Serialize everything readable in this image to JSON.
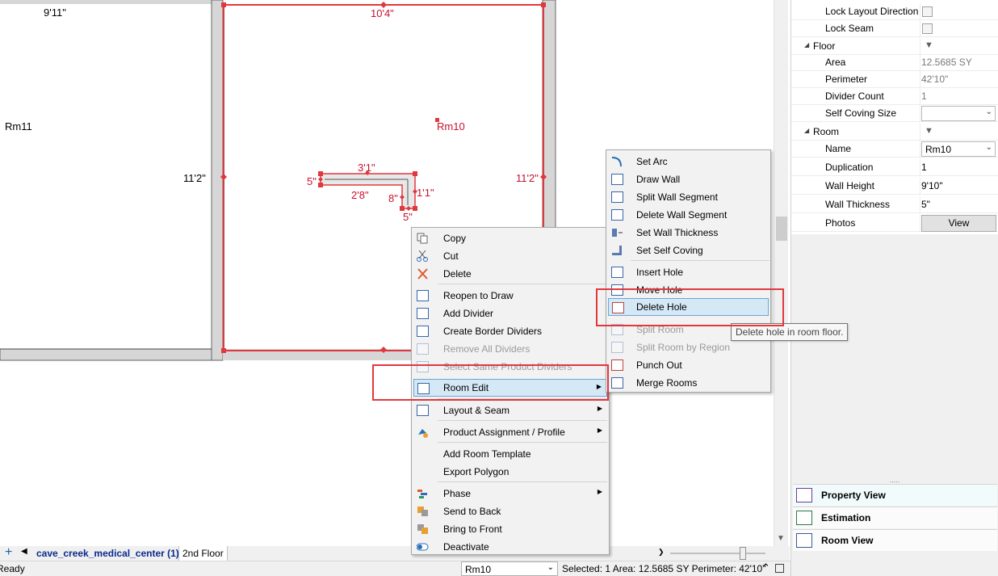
{
  "canvas": {
    "left_room": {
      "label": "Rm11",
      "dim_top": "9'11\"",
      "dim_right": "11'2\""
    },
    "room": {
      "label": "Rm10",
      "dim_top": "10'4\"",
      "dim_right": "11'2\"",
      "hole_dims": {
        "top": "3'1\"",
        "left": "5\"",
        "inner": "2'8\"",
        "step": "8\"",
        "right": "1'1\"",
        "bottom": "5\""
      }
    }
  },
  "main_menu": {
    "items": [
      {
        "label": "Copy",
        "icon": "copy-icon"
      },
      {
        "label": "Cut",
        "icon": "scissors-icon"
      },
      {
        "label": "Delete",
        "icon": "delete-x-icon"
      },
      {
        "label": "Reopen to Draw",
        "icon": "reopen-icon"
      },
      {
        "label": "Add Divider",
        "icon": "divider-icon"
      },
      {
        "label": "Create Border Dividers",
        "icon": "border-dividers-icon"
      },
      {
        "label": "Remove All Dividers",
        "icon": "remove-dividers-icon"
      },
      {
        "label": "Select Same Product Dividers",
        "icon": "select-dividers-icon"
      },
      {
        "label": "Room Edit",
        "icon": "room-edit-icon"
      },
      {
        "label": "Layout & Seam",
        "icon": "layout-seam-icon"
      },
      {
        "label": "Product Assignment / Profile",
        "icon": "product-assignment-icon"
      },
      {
        "label": "Add Room Template",
        "icon": ""
      },
      {
        "label": "Export Polygon",
        "icon": ""
      },
      {
        "label": "Phase",
        "icon": "phase-icon"
      },
      {
        "label": "Send to Back",
        "icon": "send-back-icon"
      },
      {
        "label": "Bring to Front",
        "icon": "bring-front-icon"
      },
      {
        "label": "Deactivate",
        "icon": "toggle-icon"
      }
    ]
  },
  "sub_menu": {
    "items": [
      {
        "label": "Set Arc",
        "icon": "arc-icon"
      },
      {
        "label": "Draw Wall",
        "icon": "draw-wall-icon"
      },
      {
        "label": "Split Wall Segment",
        "icon": "split-wall-icon"
      },
      {
        "label": "Delete Wall Segment",
        "icon": "delete-wall-icon"
      },
      {
        "label": "Set Wall Thickness",
        "icon": "wall-thickness-icon"
      },
      {
        "label": "Set Self Coving",
        "icon": "self-coving-icon"
      },
      {
        "label": "Insert Hole",
        "icon": "insert-hole-icon"
      },
      {
        "label": "Move Hole",
        "icon": "move-hole-icon"
      },
      {
        "label": "Delete Hole",
        "icon": "delete-hole-icon"
      },
      {
        "label": "Split Room",
        "icon": "split-room-icon"
      },
      {
        "label": "Split Room by Region",
        "icon": "split-region-icon"
      },
      {
        "label": "Punch Out",
        "icon": "punch-out-icon"
      },
      {
        "label": "Merge Rooms",
        "icon": "merge-rooms-icon"
      }
    ],
    "tooltip": "Delete hole in room floor."
  },
  "properties": {
    "lock_layout_direction": "Lock Layout Direction",
    "lock_seam": "Lock Seam",
    "floor_group": "Floor",
    "area_label": "Area",
    "area_value": "12.5685 SY",
    "perimeter_label": "Perimeter",
    "perimeter_value": "42'10\"",
    "divider_count_label": "Divider Count",
    "divider_count_value": "1",
    "self_coving_label": "Self Coving Size",
    "self_coving_value": "",
    "room_group": "Room",
    "name_label": "Name",
    "name_value": "Rm10",
    "duplication_label": "Duplication",
    "duplication_value": "1",
    "wall_height_label": "Wall Height",
    "wall_height_value": "9'10\"",
    "wall_thickness_label": "Wall Thickness",
    "wall_thickness_value": "5\"",
    "photos_label": "Photos",
    "photos_button": "View"
  },
  "nav": {
    "property_view": "Property View",
    "estimation": "Estimation",
    "room_view": "Room View"
  },
  "tabs": {
    "active": "cave_creek_medical_center (1)",
    "second": "2nd Floor"
  },
  "status": {
    "ready": "Ready",
    "room_selector": "Rm10",
    "selection": "Selected: 1 Area: 12.5685 SY Perimeter: 42'10\""
  },
  "colors": {
    "wall_outline": "#e0383d",
    "dimension_text": "#c8102e",
    "highlight": "#d5e8f5"
  }
}
